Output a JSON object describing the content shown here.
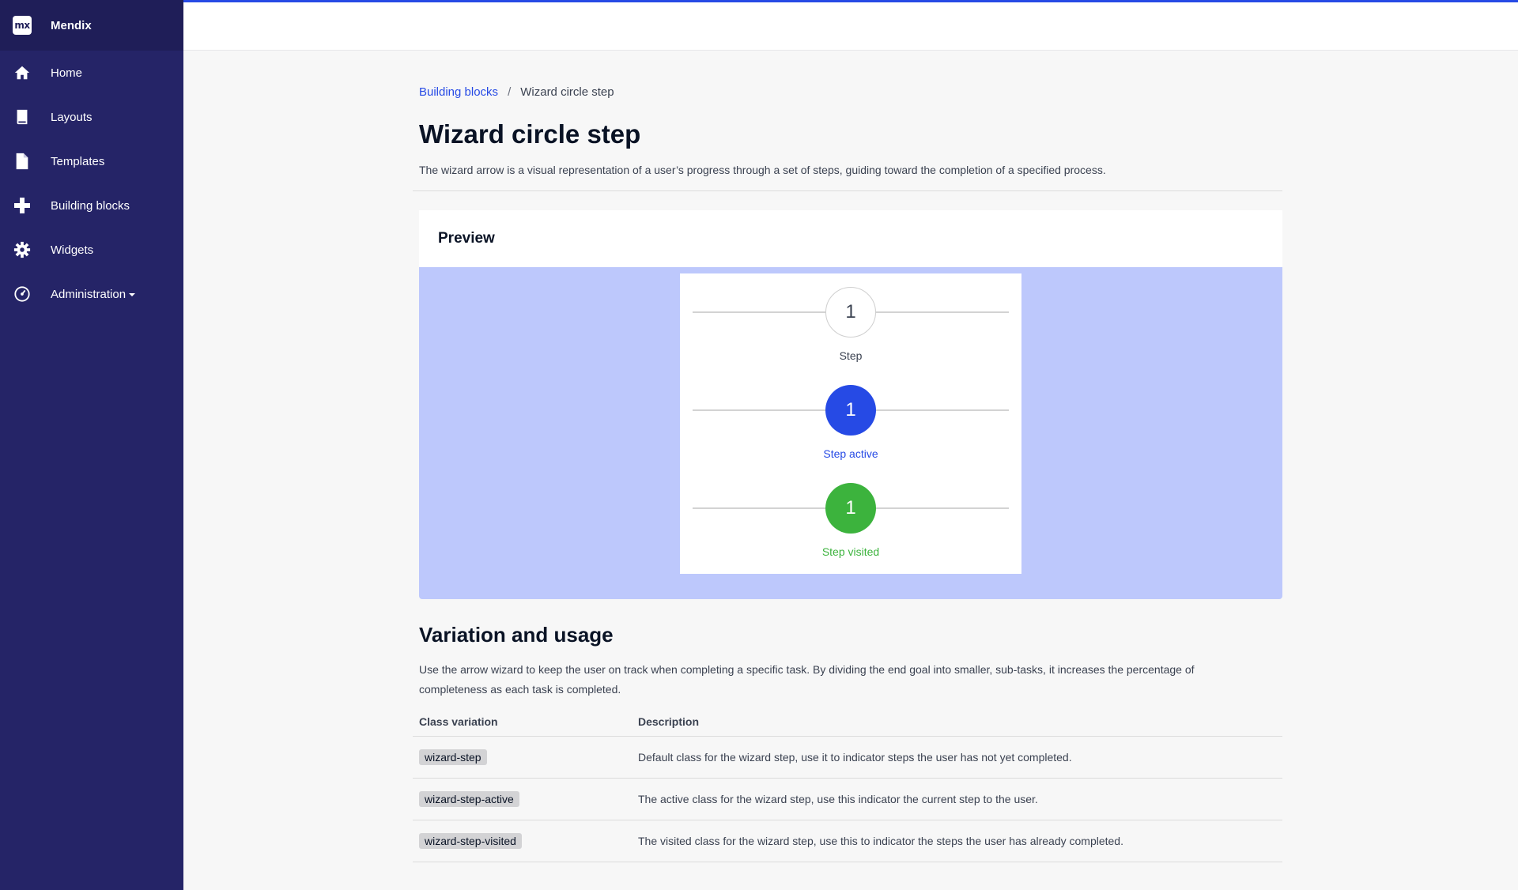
{
  "app": {
    "name": "Mendix",
    "logo_text": "mx"
  },
  "sidebar": {
    "items": [
      {
        "label": "Home",
        "icon": "home-icon"
      },
      {
        "label": "Layouts",
        "icon": "book-icon"
      },
      {
        "label": "Templates",
        "icon": "document-icon"
      },
      {
        "label": "Building blocks",
        "icon": "plus-icon"
      },
      {
        "label": "Widgets",
        "icon": "gear-icon"
      },
      {
        "label": "Administration",
        "icon": "dashboard-icon",
        "has_dropdown": true
      }
    ]
  },
  "breadcrumb": {
    "parent": "Building blocks",
    "separator": "/",
    "current": "Wizard circle step"
  },
  "page": {
    "title": "Wizard circle step",
    "description": "The wizard arrow is a visual representation of a user’s progress through a set of steps, guiding toward the completion of a specified process."
  },
  "preview": {
    "heading": "Preview",
    "steps": [
      {
        "number": "1",
        "label": "Step",
        "state": "default"
      },
      {
        "number": "1",
        "label": "Step active",
        "state": "active"
      },
      {
        "number": "1",
        "label": "Step visited",
        "state": "visited"
      }
    ]
  },
  "variation": {
    "title": "Variation and usage",
    "description": "Use the arrow wizard to keep the user on track when completing a specific task. By dividing the end goal into smaller, sub-tasks, it increases the percentage of completeness as each task is completed.",
    "table": {
      "headers": [
        "Class variation",
        "Description"
      ],
      "rows": [
        {
          "class": "wizard-step",
          "description": "Default class for the wizard step, use it to indicator steps the user has not yet completed."
        },
        {
          "class": "wizard-step-active",
          "description": "The active class for the wizard step, use this indicator the current step to the user."
        },
        {
          "class": "wizard-step-visited",
          "description": "The visited class for the wizard step, use this to indicator the steps the user has already completed."
        }
      ]
    }
  },
  "colors": {
    "sidebar": "#252467",
    "brand_bar": "#1f1e58",
    "accent": "#264ae5",
    "visited": "#3cb33d",
    "preview_bg": "#bdc8fc"
  }
}
